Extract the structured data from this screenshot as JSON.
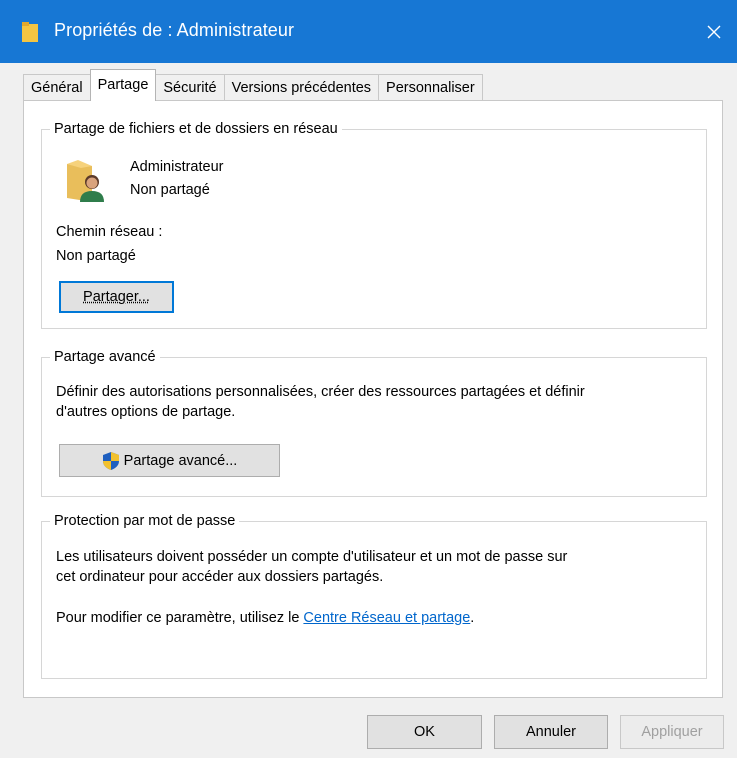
{
  "window": {
    "title": "Propriétés de : Administrateur",
    "close_glyph": "✕"
  },
  "tabs": [
    {
      "label": "Général"
    },
    {
      "label": "Partage"
    },
    {
      "label": "Sécurité"
    },
    {
      "label": "Versions précédentes"
    },
    {
      "label": "Personnaliser"
    }
  ],
  "active_tab": "Partage",
  "network_sharing": {
    "legend": "Partage de fichiers et de dossiers en réseau",
    "folder_name": "Administrateur",
    "folder_status": "Non partagé",
    "network_path_label": "Chemin réseau :",
    "network_path_value": "Non partagé",
    "share_button": "Partager..."
  },
  "advanced_sharing": {
    "legend": "Partage avancé",
    "description_line1": "Définir des autorisations personnalisées, créer des ressources partagées et définir",
    "description_line2": "d'autres options de partage.",
    "button": "Partage avancé..."
  },
  "password_protection": {
    "legend": "Protection par mot de passe",
    "line1": "Les utilisateurs doivent posséder un compte d'utilisateur et un mot de passe sur",
    "line2": "cet ordinateur pour accéder aux dossiers partagés.",
    "line3_prefix": "Pour modifier ce paramètre, utilisez le ",
    "link": "Centre Réseau et partage",
    "line3_suffix": "."
  },
  "footer": {
    "ok": "OK",
    "cancel": "Annuler",
    "apply": "Appliquer"
  },
  "colors": {
    "titlebar": "#1777d4",
    "link": "#0066cc",
    "focus_border": "#0078d7"
  }
}
